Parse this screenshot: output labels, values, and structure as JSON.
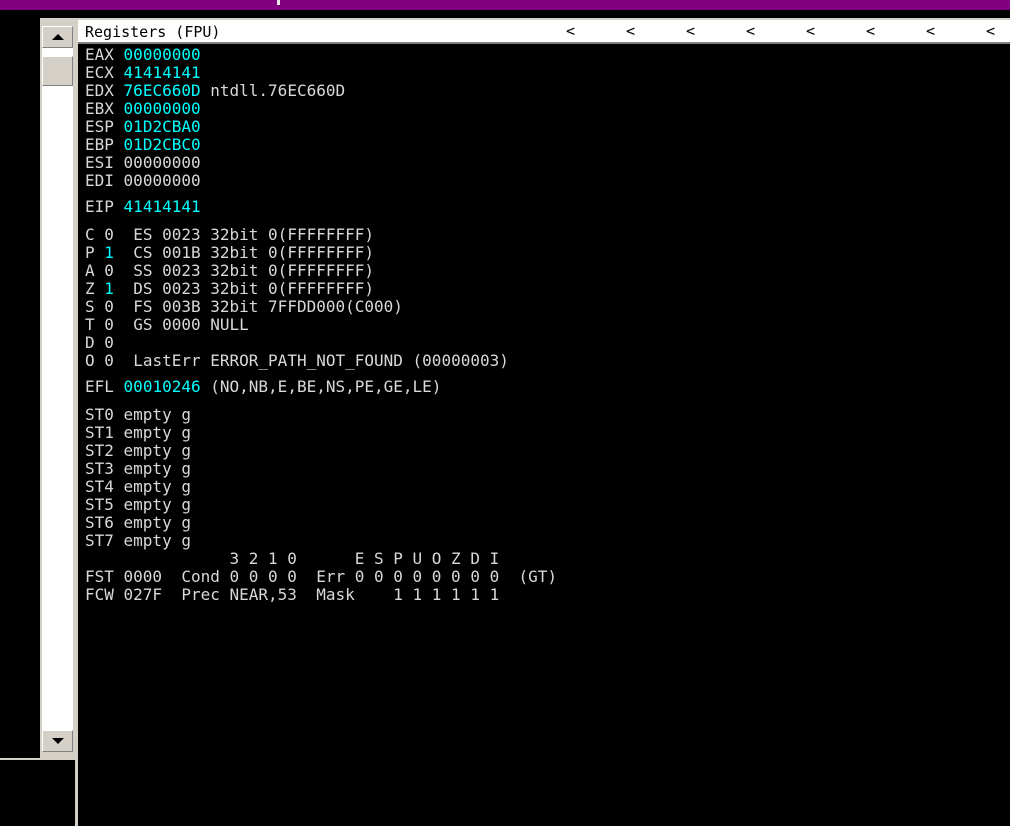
{
  "panel_title": "Registers (FPU)",
  "chevrons": [
    "<",
    "<",
    "<",
    "<",
    "<",
    "<",
    "<",
    "<"
  ],
  "registers": [
    {
      "name": "EAX",
      "value": "00000000",
      "note": ""
    },
    {
      "name": "ECX",
      "value": "41414141",
      "note": ""
    },
    {
      "name": "EDX",
      "value": "76EC660D",
      "note": "ntdll.76EC660D"
    },
    {
      "name": "EBX",
      "value": "00000000",
      "note": ""
    },
    {
      "name": "ESP",
      "value": "01D2CBA0",
      "note": ""
    },
    {
      "name": "EBP",
      "value": "01D2CBC0",
      "note": ""
    },
    {
      "name": "ESI",
      "value": "00000000",
      "note": ""
    },
    {
      "name": "EDI",
      "value": "00000000",
      "note": ""
    }
  ],
  "eip": {
    "name": "EIP",
    "value": "41414141"
  },
  "flags": [
    {
      "flag": "C",
      "val": "0",
      "rest": "  ES 0023 32bit 0(FFFFFFFF)"
    },
    {
      "flag": "P",
      "val": "1",
      "rest": "  CS 001B 32bit 0(FFFFFFFF)"
    },
    {
      "flag": "A",
      "val": "0",
      "rest": "  SS 0023 32bit 0(FFFFFFFF)"
    },
    {
      "flag": "Z",
      "val": "1",
      "rest": "  DS 0023 32bit 0(FFFFFFFF)"
    },
    {
      "flag": "S",
      "val": "0",
      "rest": "  FS 003B 32bit 7FFDD000(C000)"
    },
    {
      "flag": "T",
      "val": "0",
      "rest": "  GS 0000 NULL"
    },
    {
      "flag": "D",
      "val": "0",
      "rest": ""
    },
    {
      "flag": "O",
      "val": "0",
      "rest": "  LastErr ERROR_PATH_NOT_FOUND (00000003)"
    }
  ],
  "efl": {
    "name": "EFL",
    "value": "00010246",
    "note": "(NO,NB,E,BE,NS,PE,GE,LE)"
  },
  "st": [
    "ST0 empty g",
    "ST1 empty g",
    "ST2 empty g",
    "ST3 empty g",
    "ST4 empty g",
    "ST5 empty g",
    "ST6 empty g",
    "ST7 empty g"
  ],
  "fpu_header": "               3 2 1 0      E S P U O Z D I",
  "fst": "FST 0000  Cond 0 0 0 0  Err 0 0 0 0 0 0 0 0  (GT)",
  "fcw": "FCW 027F  Prec NEAR,53  Mask    1 1 1 1 1 1",
  "colors": {
    "highlight": "#00ffff",
    "text": "#d8d8d8",
    "title_bar": "#800080"
  }
}
